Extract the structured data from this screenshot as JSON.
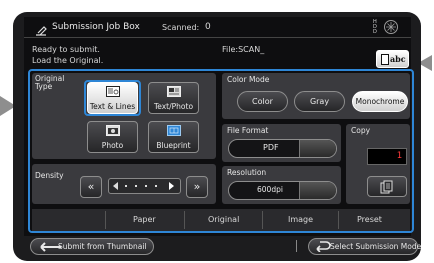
{
  "header": {
    "title": "Submission Job Box",
    "scanned_label": "Scanned:",
    "scanned_value": "0"
  },
  "status": {
    "line1": "Ready to submit.",
    "line2": "Load the Original.",
    "file_label": "File:SCAN_"
  },
  "abc_button": {
    "label": "abc"
  },
  "original_type": {
    "title_line1": "Original",
    "title_line2": "Type",
    "options": [
      "Text & Lines",
      "Text/Photo",
      "Photo",
      "Blueprint"
    ],
    "selected": "Text & Lines"
  },
  "color_mode": {
    "title": "Color Mode",
    "options": [
      "Color",
      "Gray",
      "Monochrome"
    ],
    "selected": "Monochrome"
  },
  "file_format": {
    "title": "File Format",
    "value": "PDF"
  },
  "resolution": {
    "title": "Resolution",
    "value": "600dpi"
  },
  "copy": {
    "title": "Copy",
    "value": "1"
  },
  "density": {
    "title": "Density",
    "level_fraction": 0.7
  },
  "tabs": [
    "Paper",
    "Original",
    "Image",
    "Preset"
  ],
  "footer": {
    "left_button": "Submit from Thumbnail",
    "right_button": "Select Submission Mode"
  },
  "colors": {
    "accent": "#2e86d6",
    "panel": "#3a3a3e",
    "selected": "#f0f0f0"
  }
}
